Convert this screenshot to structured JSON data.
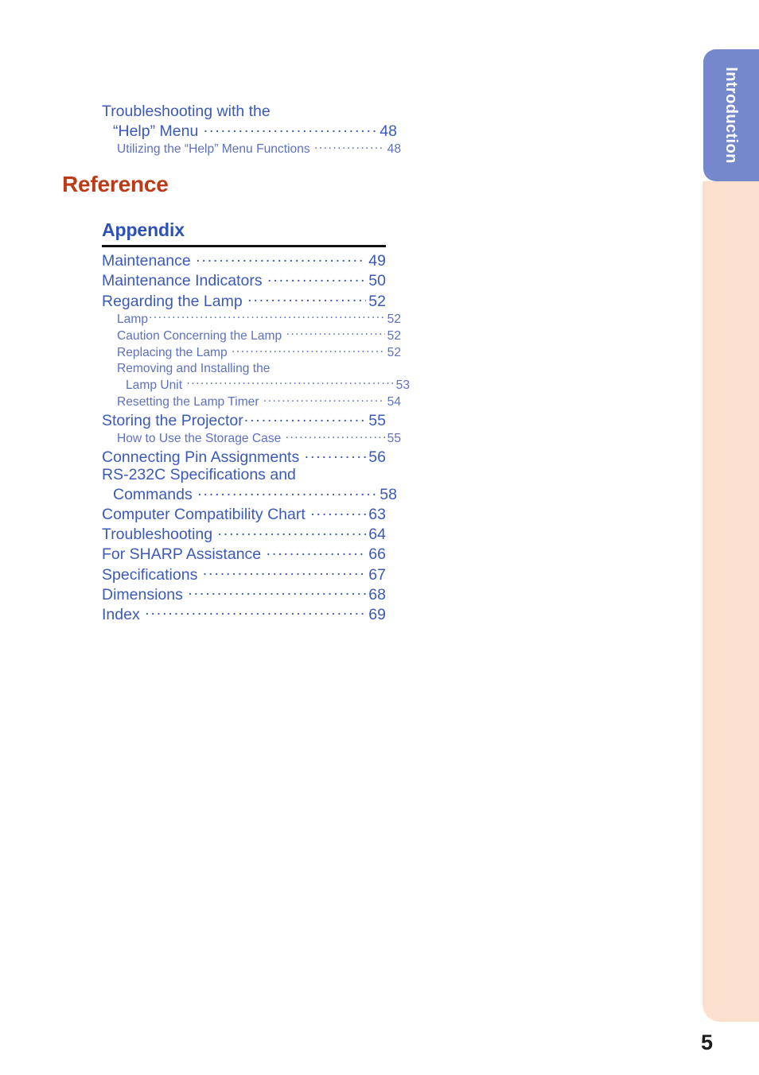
{
  "page": {
    "number": "5",
    "side_tab_label": "Introduction",
    "tab_color": "#7588CC",
    "side_panel_color": "#FBE0CE",
    "heading_reference_color": "#BC3A16",
    "heading_appendix_color": "#2D52B5",
    "level1_text_color": "#3B5AB8",
    "level2_text_color": "#5D71BE"
  },
  "top_section": {
    "entries": [
      {
        "level": 1,
        "wrap_first_line": "Troubleshooting with the",
        "label": "“Help” Menu ",
        "page": "48"
      },
      {
        "level": 2,
        "label": "Utilizing the “Help” Menu Functions ",
        "page": "48"
      }
    ]
  },
  "reference_section": {
    "title": "Reference",
    "appendix": {
      "title": "Appendix",
      "entries": [
        {
          "level": 1,
          "label": "Maintenance ",
          "page": "49"
        },
        {
          "level": 1,
          "label": "Maintenance Indicators ",
          "page": "50"
        },
        {
          "level": 1,
          "label": "Regarding the Lamp ",
          "page": "52"
        },
        {
          "level": 2,
          "label": "Lamp",
          "page": "52"
        },
        {
          "level": 2,
          "label": "Caution Concerning the Lamp ",
          "page": "52"
        },
        {
          "level": 2,
          "label": "Replacing the Lamp ",
          "page": "52"
        },
        {
          "level": 2,
          "wrap_first_line": "Removing and Installing the",
          "label": "Lamp Unit ",
          "page": "53"
        },
        {
          "level": 2,
          "label": "Resetting the Lamp Timer ",
          "page": "54"
        },
        {
          "level": 1,
          "label": "Storing the Projector",
          "page": "55"
        },
        {
          "level": 2,
          "label": "How to Use the Storage Case ",
          "page": "55"
        },
        {
          "level": 1,
          "label": "Connecting Pin Assignments ",
          "page": "56"
        },
        {
          "level": 1,
          "wrap_first_line": "RS-232C Specifications and",
          "label": "Commands ",
          "page": "58"
        },
        {
          "level": 1,
          "label": "Computer Compatibility Chart ",
          "page": "63"
        },
        {
          "level": 1,
          "label": "Troubleshooting ",
          "page": "64"
        },
        {
          "level": 1,
          "label": "For SHARP Assistance ",
          "page": "66"
        },
        {
          "level": 1,
          "label": "Specifications ",
          "page": "67"
        },
        {
          "level": 1,
          "label": "Dimensions ",
          "page": "68"
        },
        {
          "level": 1,
          "label": "Index ",
          "page": "69"
        }
      ]
    }
  }
}
